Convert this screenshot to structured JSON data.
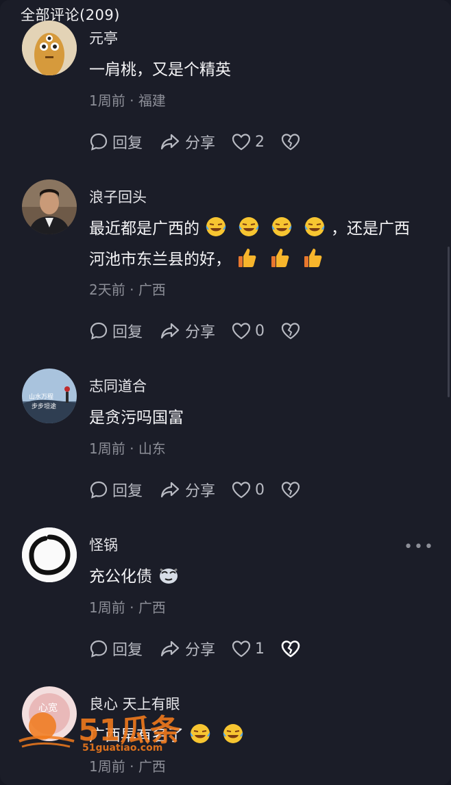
{
  "header": {
    "title": "全部评论(209)"
  },
  "actions": {
    "reply": "回复",
    "share": "分享"
  },
  "comments": [
    {
      "name": "元亭",
      "text": "一肩桃，又是个精英",
      "time": "1周前",
      "location": "福建",
      "likes": "2"
    },
    {
      "name": "浪子回头",
      "text_a": "最近都是广西的",
      "text_b": "，还是广西",
      "text_c": "河池市东兰县的好，",
      "time": "2天前",
      "location": "广西",
      "likes": "0"
    },
    {
      "name": "志同道合",
      "text": "是贪污吗国富",
      "time": "1周前",
      "location": "山东",
      "likes": "0"
    },
    {
      "name": "怪锅",
      "text": "充公化债",
      "time": "1周前",
      "location": "广西",
      "likes": "1"
    },
    {
      "name": "良心 天上有眼",
      "text_a": "广西早有名了",
      "time": "1周前",
      "location": "广西"
    }
  ],
  "watermark": {
    "brand": "51瓜条",
    "url": "51guatiao.com"
  },
  "colors": {
    "background": "#1b1d28",
    "meta": "#8d8f98",
    "accent_watermark": "#f07a1c"
  }
}
